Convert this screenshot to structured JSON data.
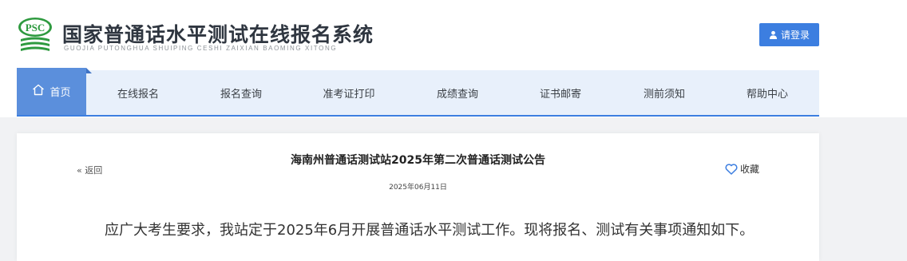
{
  "header": {
    "logo_text": "PSC",
    "title": "国家普通话水平测试在线报名系统",
    "subtitle": "GUOJIA PUTONGHUA SHUIPING CESHI ZAIXIAN BAOMING XITONG",
    "login_label": "请登录"
  },
  "nav": {
    "items": [
      {
        "label": "首页",
        "active": true
      },
      {
        "label": "在线报名"
      },
      {
        "label": "报名查询"
      },
      {
        "label": "准考证打印"
      },
      {
        "label": "成绩查询"
      },
      {
        "label": "证书邮寄"
      },
      {
        "label": "测前须知"
      },
      {
        "label": "帮助中心"
      }
    ]
  },
  "article": {
    "back_label": "« 返回",
    "title": "海南州普通话测试站2025年第二次普通话测试公告",
    "date": "2025年06月11日",
    "favorite_label": "收藏",
    "body": "应广大考生要求，我站定于2025年6月开展普通话水平测试工作。现将报名、测试有关事项通知如下。"
  },
  "colors": {
    "accent": "#3c7ee0",
    "nav_bg": "#e8f0fb",
    "nav_active": "#5b8fdc",
    "logo_green": "#2e9a3f"
  },
  "icons": {
    "logo": "psc-logo-icon",
    "login": "user-icon",
    "home": "home-icon",
    "favorite": "heart-icon"
  }
}
